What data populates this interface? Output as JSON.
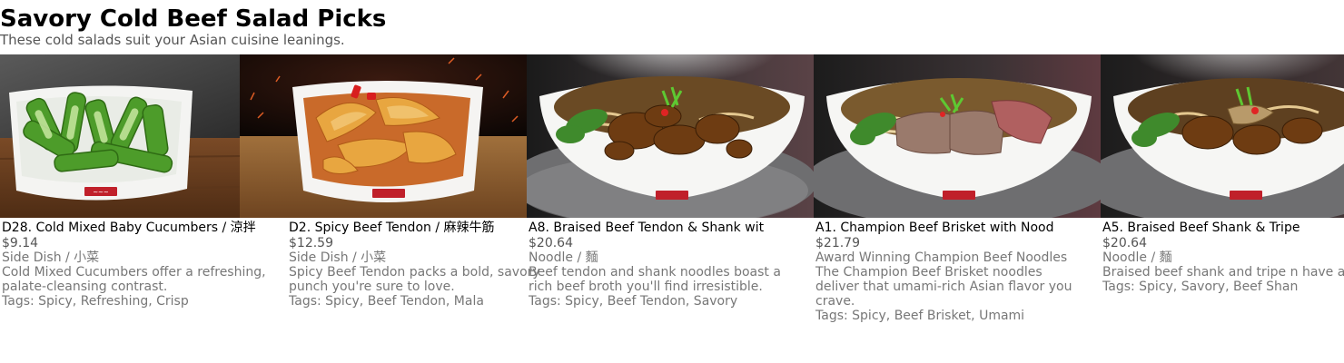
{
  "page": {
    "title": "Savory Cold Beef Salad Picks",
    "subtitle": "These cold salads suit your Asian cuisine leanings."
  },
  "cards": [
    {
      "name": "D28. Cold Mixed Baby Cucumbers / 涼拌",
      "price": "$9.14",
      "category": "Side Dish / 小菜",
      "description": "Cold Mixed Cucumbers offer a refreshing, palate-cleansing contrast.",
      "tags": "Tags: Spicy, Refreshing, Crisp",
      "icon": "cucumber-dish-photo"
    },
    {
      "name": "D2. Spicy Beef Tendon / 麻辣牛筋",
      "price": "$12.59",
      "category": "Side Dish / 小菜",
      "description": "Spicy Beef Tendon packs a bold, savory punch you're sure to love.",
      "tags": "Tags: Spicy, Beef Tendon, Mala",
      "icon": "beef-tendon-dish-photo"
    },
    {
      "name": "A8. Braised Beef Tendon & Shank wit",
      "price": "$20.64",
      "category": "Noodle / 麵",
      "description": "Beef tendon and shank noodles boast a rich beef broth you'll find irresistible.",
      "tags": "Tags: Spicy, Beef Tendon, Savory",
      "icon": "noodle-bowl-photo"
    },
    {
      "name": "A1. Champion Beef Brisket with Nood",
      "price": "$21.79",
      "category": "Award Winning Champion Beef Noodles",
      "description": "The Champion Beef Brisket noodles deliver that umami-rich Asian flavor you crave.",
      "tags": "Tags: Spicy, Beef Brisket, Umami",
      "icon": "noodle-bowl-photo"
    },
    {
      "name": "A5. Braised Beef Shank & Tripe",
      "price": "$20.64",
      "category": "Noodle / 麵",
      "description": "Braised beef shank and tripe n have a dark broth and just enc",
      "tags": "Tags: Spicy, Savory, Beef Shan",
      "icon": "noodle-bowl-photo"
    }
  ],
  "colors": {
    "subtitle": "#555555",
    "meta_text": "#777777"
  }
}
